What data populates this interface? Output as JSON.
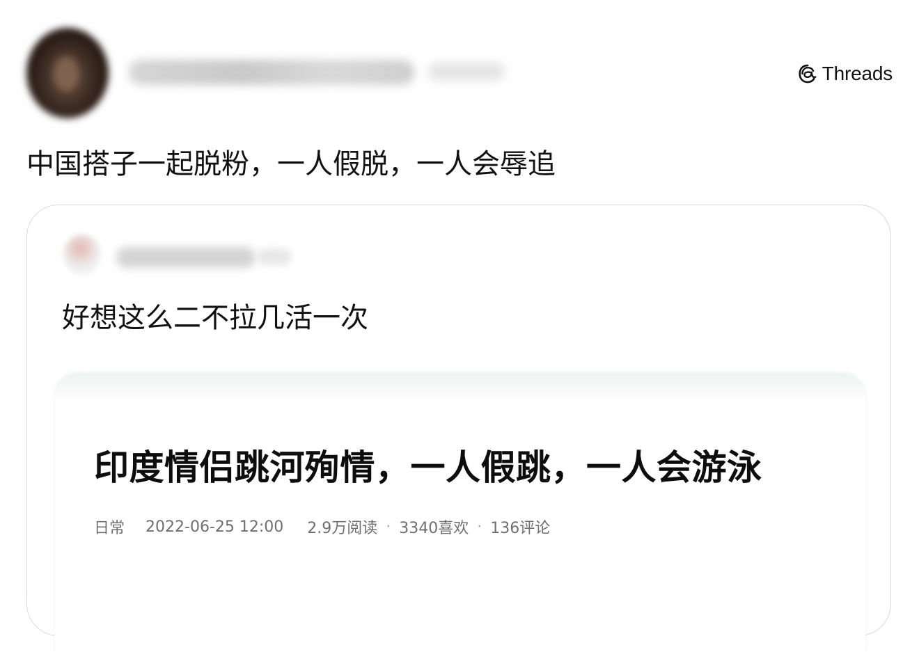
{
  "header": {
    "brand_label": "Threads",
    "brand_icon": "threads-logo-icon"
  },
  "post": {
    "text": "中国搭子一起脱粉，一人假脱，一人会辱追"
  },
  "quoted_post": {
    "text": "好想这么二不拉几活一次",
    "article": {
      "title": "印度情侣跳河殉情，一人假跳，一人会游泳",
      "category": "日常",
      "date": "2022-06-25 12:00",
      "reads": "2.9万阅读",
      "likes": "3340喜欢",
      "comments": "136评论",
      "separator": "·"
    }
  }
}
